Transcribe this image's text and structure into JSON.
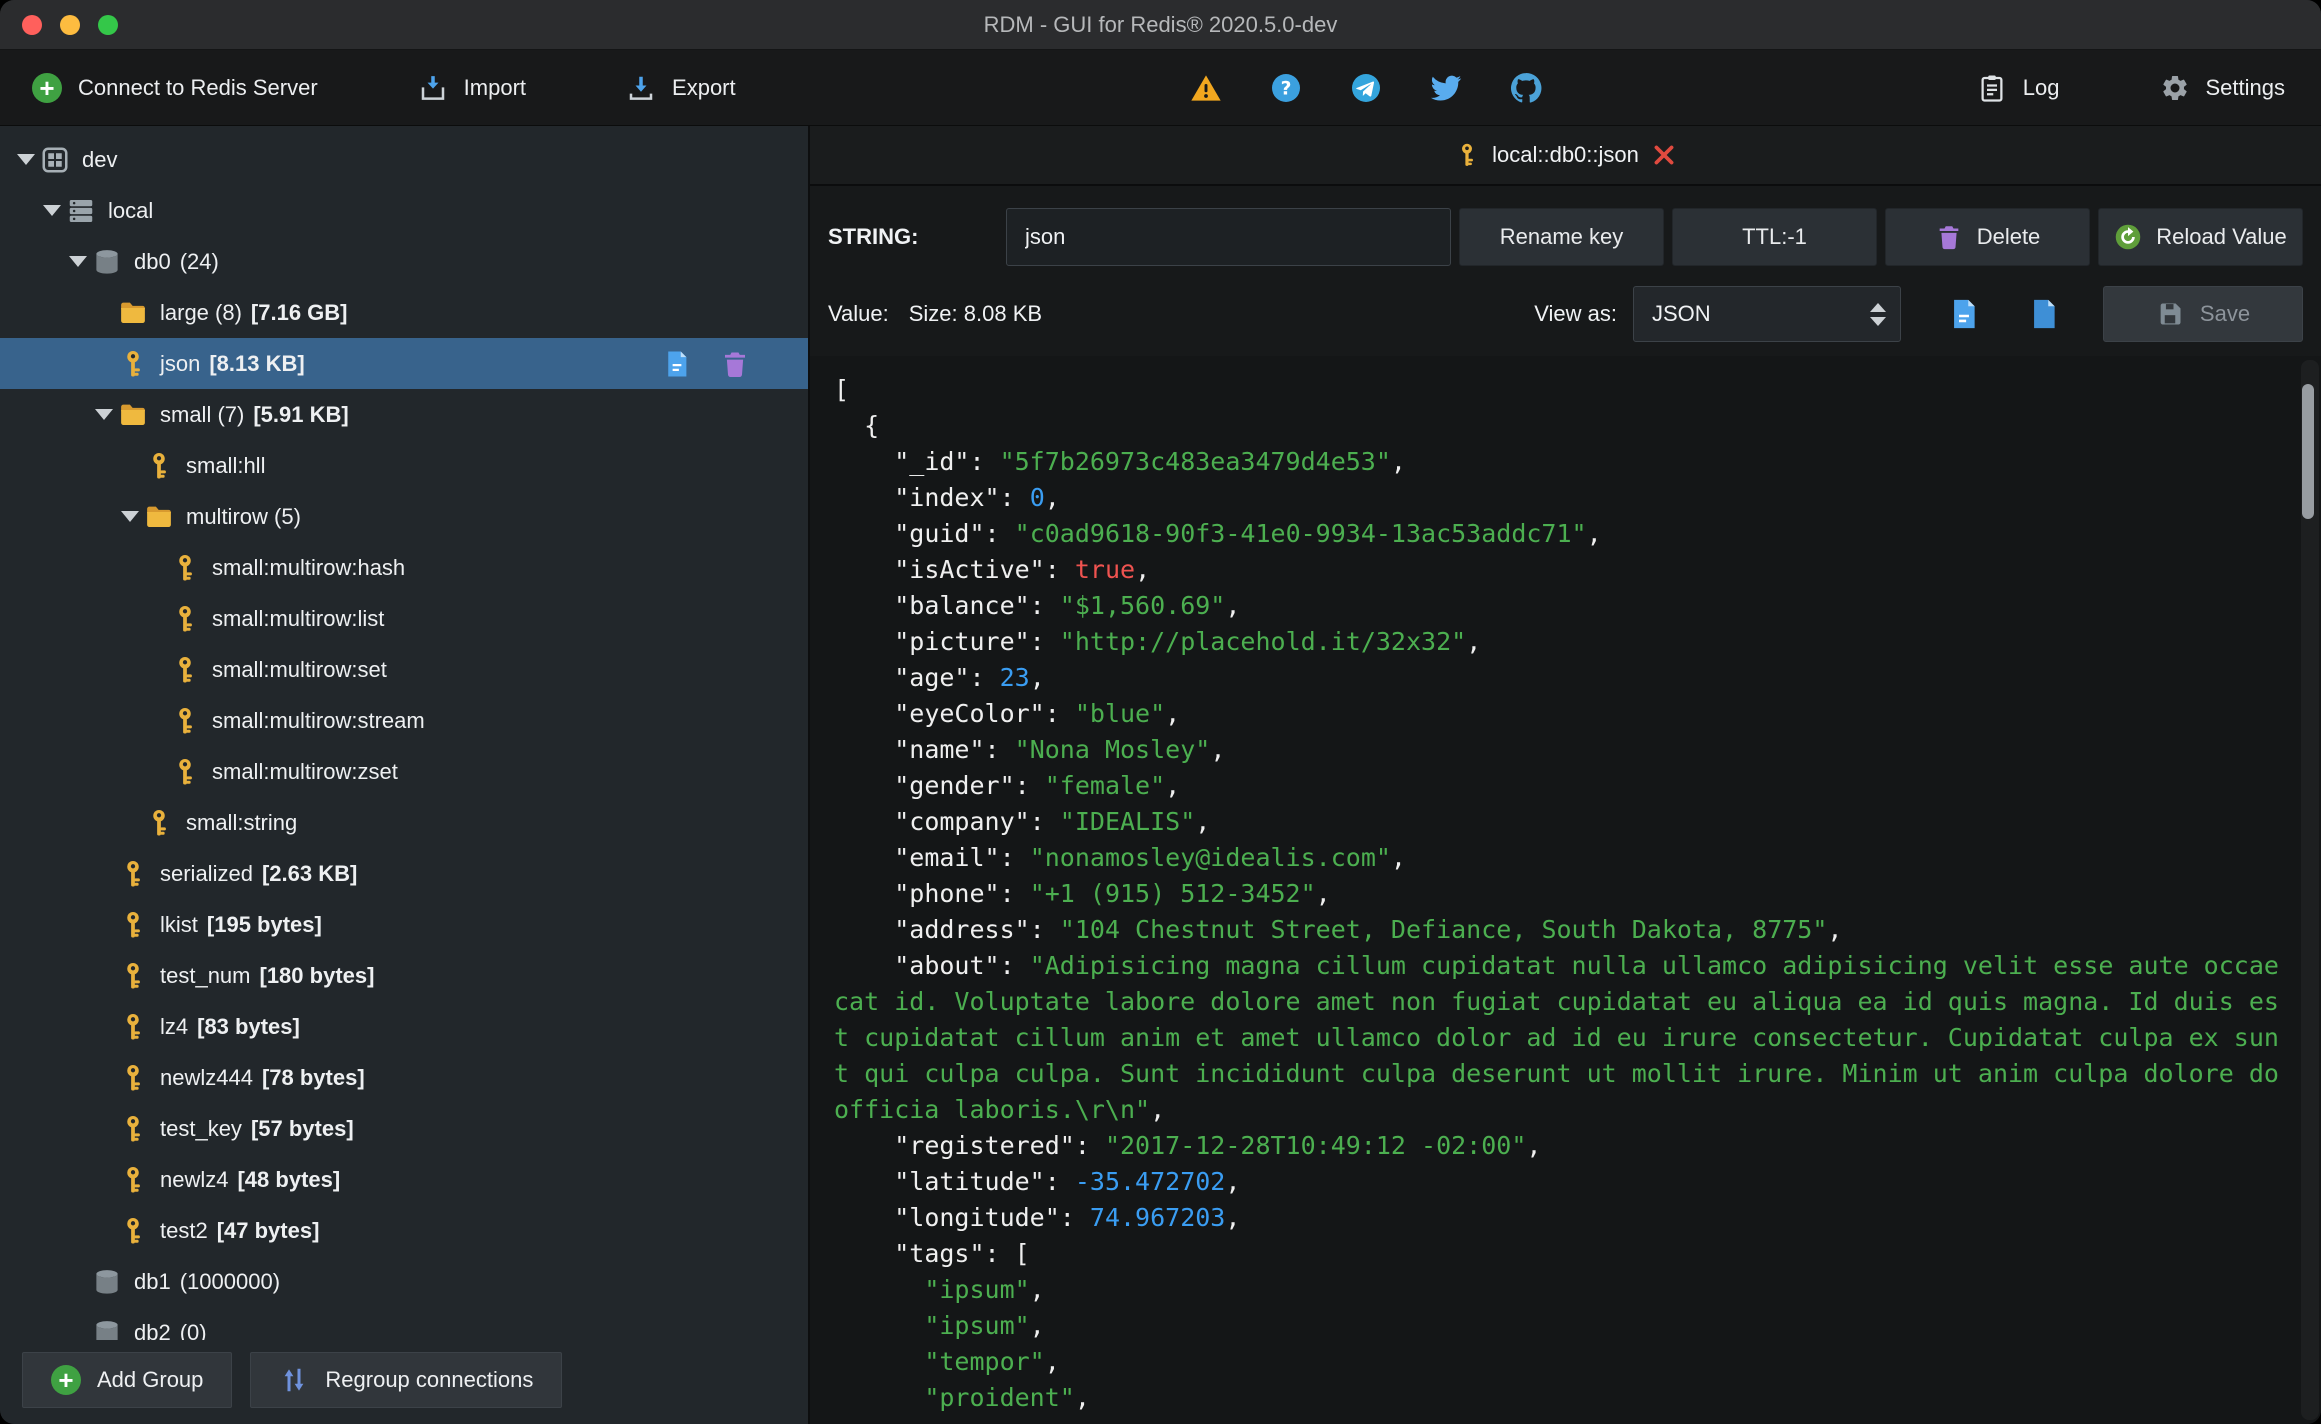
{
  "window": {
    "title": "RDM - GUI for Redis® 2020.5.0-dev"
  },
  "toolbar": {
    "connect_label": "Connect to Redis Server",
    "import_label": "Import",
    "export_label": "Export",
    "log_label": "Log",
    "settings_label": "Settings",
    "icons": [
      "warning-icon",
      "help-icon",
      "telegram-icon",
      "twitter-icon",
      "github-icon"
    ]
  },
  "sidebar": {
    "tree": [
      {
        "level": 0,
        "icon": "group",
        "expanded": true,
        "label": "dev"
      },
      {
        "level": 1,
        "icon": "server",
        "expanded": true,
        "label": "local"
      },
      {
        "level": 2,
        "icon": "db",
        "expanded": true,
        "label": "db0",
        "suffix": "(24)"
      },
      {
        "level": 3,
        "icon": "folder",
        "label": "large (8)",
        "size": "[7.16 GB]"
      },
      {
        "level": 3,
        "icon": "key",
        "label": "json",
        "size": "[8.13 KB]",
        "selected": true
      },
      {
        "level": 3,
        "icon": "folder",
        "expanded": true,
        "label": "small (7)",
        "size": "[5.91 KB]"
      },
      {
        "level": 4,
        "icon": "key",
        "label": "small:hll"
      },
      {
        "level": 4,
        "icon": "folder",
        "expanded": true,
        "label": "multirow (5)"
      },
      {
        "level": 5,
        "icon": "key",
        "label": "small:multirow:hash"
      },
      {
        "level": 5,
        "icon": "key",
        "label": "small:multirow:list"
      },
      {
        "level": 5,
        "icon": "key",
        "label": "small:multirow:set"
      },
      {
        "level": 5,
        "icon": "key",
        "label": "small:multirow:stream"
      },
      {
        "level": 5,
        "icon": "key",
        "label": "small:multirow:zset"
      },
      {
        "level": 4,
        "icon": "key",
        "label": "small:string"
      },
      {
        "level": 3,
        "icon": "key",
        "label": "serialized",
        "size": "[2.63 KB]"
      },
      {
        "level": 3,
        "icon": "key",
        "label": "lkist",
        "size": "[195 bytes]"
      },
      {
        "level": 3,
        "icon": "key",
        "label": "test_num",
        "size": "[180 bytes]"
      },
      {
        "level": 3,
        "icon": "key",
        "label": "lz4",
        "size": "[83 bytes]"
      },
      {
        "level": 3,
        "icon": "key",
        "label": "newlz444",
        "size": "[78 bytes]"
      },
      {
        "level": 3,
        "icon": "key",
        "label": "test_key",
        "size": "[57 bytes]"
      },
      {
        "level": 3,
        "icon": "key",
        "label": "newlz4",
        "size": "[48 bytes]"
      },
      {
        "level": 3,
        "icon": "key",
        "label": "test2",
        "size": "[47 bytes]"
      },
      {
        "level": 2,
        "icon": "db",
        "label": "db1",
        "suffix": "(1000000)"
      },
      {
        "level": 2,
        "icon": "db",
        "label": "db2",
        "suffix": "(0)"
      }
    ],
    "footer": {
      "add_group_label": "Add Group",
      "regroup_label": "Regroup connections"
    }
  },
  "editor": {
    "tab": {
      "title": "local::db0::json"
    },
    "type_label": "STRING:",
    "key_name": "json",
    "rename_label": "Rename key",
    "ttl_label": "TTL:-1",
    "delete_label": "Delete",
    "reload_label": "Reload Value",
    "value_label": "Value:",
    "size_label": "Size: 8.08 KB",
    "view_as_label": "View as:",
    "view_as_value": "JSON",
    "save_label": "Save",
    "json_lines": [
      [
        [
          "w",
          "["
        ]
      ],
      [
        [
          "w",
          "  {"
        ]
      ],
      [
        [
          "w",
          "    \"_id\": "
        ],
        [
          "s",
          "\"5f7b26973c483ea3479d4e53\""
        ],
        [
          "w",
          ","
        ]
      ],
      [
        [
          "w",
          "    \"index\": "
        ],
        [
          "n",
          "0"
        ],
        [
          "w",
          ","
        ]
      ],
      [
        [
          "w",
          "    \"guid\": "
        ],
        [
          "s",
          "\"c0ad9618-90f3-41e0-9934-13ac53addc71\""
        ],
        [
          "w",
          ","
        ]
      ],
      [
        [
          "w",
          "    \"isActive\": "
        ],
        [
          "b",
          "true"
        ],
        [
          "w",
          ","
        ]
      ],
      [
        [
          "w",
          "    \"balance\": "
        ],
        [
          "s",
          "\"$1,560.69\""
        ],
        [
          "w",
          ","
        ]
      ],
      [
        [
          "w",
          "    \"picture\": "
        ],
        [
          "s",
          "\"http://placehold.it/32x32\""
        ],
        [
          "w",
          ","
        ]
      ],
      [
        [
          "w",
          "    \"age\": "
        ],
        [
          "n",
          "23"
        ],
        [
          "w",
          ","
        ]
      ],
      [
        [
          "w",
          "    \"eyeColor\": "
        ],
        [
          "s",
          "\"blue\""
        ],
        [
          "w",
          ","
        ]
      ],
      [
        [
          "w",
          "    \"name\": "
        ],
        [
          "s",
          "\"Nona Mosley\""
        ],
        [
          "w",
          ","
        ]
      ],
      [
        [
          "w",
          "    \"gender\": "
        ],
        [
          "s",
          "\"female\""
        ],
        [
          "w",
          ","
        ]
      ],
      [
        [
          "w",
          "    \"company\": "
        ],
        [
          "s",
          "\"IDEALIS\""
        ],
        [
          "w",
          ","
        ]
      ],
      [
        [
          "w",
          "    \"email\": "
        ],
        [
          "s",
          "\"nonamosley@idealis.com\""
        ],
        [
          "w",
          ","
        ]
      ],
      [
        [
          "w",
          "    \"phone\": "
        ],
        [
          "s",
          "\"+1 (915) 512-3452\""
        ],
        [
          "w",
          ","
        ]
      ],
      [
        [
          "w",
          "    \"address\": "
        ],
        [
          "s",
          "\"104 Chestnut Street, Defiance, South Dakota, 8775\""
        ],
        [
          "w",
          ","
        ]
      ],
      [
        [
          "w",
          "    \"about\": "
        ],
        [
          "s",
          "\"Adipisicing magna cillum cupidatat nulla ullamco adipisicing velit esse aute occaecat id. Voluptate labore dolore amet non fugiat cupidatat eu aliqua ea id quis magna. Id duis est cupidatat cillum anim et amet ullamco dolor ad id eu irure consectetur. Cupidatat culpa ex sunt qui culpa culpa. Sunt incididunt culpa deserunt ut mollit irure. Minim ut anim culpa dolore do officia laboris.\\r\\n\""
        ],
        [
          "w",
          ","
        ]
      ],
      [
        [
          "w",
          "    \"registered\": "
        ],
        [
          "s",
          "\"2017-12-28T10:49:12 -02:00\""
        ],
        [
          "w",
          ","
        ]
      ],
      [
        [
          "w",
          "    \"latitude\": "
        ],
        [
          "n",
          "-35.472702"
        ],
        [
          "w",
          ","
        ]
      ],
      [
        [
          "w",
          "    \"longitude\": "
        ],
        [
          "n",
          "74.967203"
        ],
        [
          "w",
          ","
        ]
      ],
      [
        [
          "w",
          "    \"tags\": ["
        ]
      ],
      [
        [
          "w",
          "      "
        ],
        [
          "s",
          "\"ipsum\""
        ],
        [
          "w",
          ","
        ]
      ],
      [
        [
          "w",
          "      "
        ],
        [
          "s",
          "\"ipsum\""
        ],
        [
          "w",
          ","
        ]
      ],
      [
        [
          "w",
          "      "
        ],
        [
          "s",
          "\"tempor\""
        ],
        [
          "w",
          ","
        ]
      ],
      [
        [
          "w",
          "      "
        ],
        [
          "s",
          "\"proident\""
        ],
        [
          "w",
          ","
        ]
      ]
    ]
  },
  "colors": {
    "accent-selected": "#38638c",
    "json-string": "#4caf50",
    "json-number": "#3a9df2",
    "json-bool": "#ef5350",
    "json-plain": "#efefef",
    "key-gold": "#e9b13c",
    "folder-gold": "#efb93f",
    "success-green": "#3fa142",
    "danger-red": "#e04a3f"
  }
}
